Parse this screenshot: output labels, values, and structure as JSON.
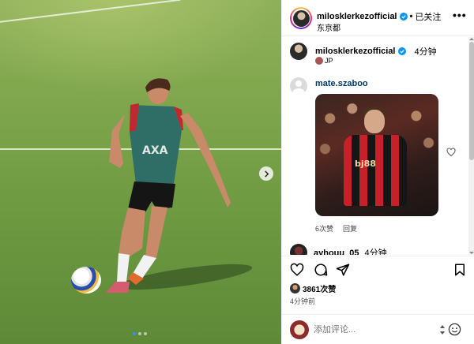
{
  "post": {
    "carousel": {
      "slides": 3,
      "active": 0
    }
  },
  "header": {
    "username": "milosklerkezofficial",
    "follow_status": "已关注",
    "location": "东京都",
    "more": "•••"
  },
  "caption": {
    "username": "milosklerkezofficial",
    "time": "4分钟",
    "tag": "JP"
  },
  "comments": [
    {
      "username": "mate.szaboo",
      "image_text": "bj88",
      "likes": "6次赞",
      "reply": "回复"
    },
    {
      "username": "ayhouu_05",
      "time": "4分钟"
    }
  ],
  "actions": {
    "likes_count": "3861次赞",
    "posted": "4分钟前"
  },
  "add_comment": {
    "placeholder": "添加评论..."
  },
  "colors": {
    "verified": "#0095f6",
    "link_user": "#00376b",
    "carousel_dot_active": "#3c8dee"
  }
}
